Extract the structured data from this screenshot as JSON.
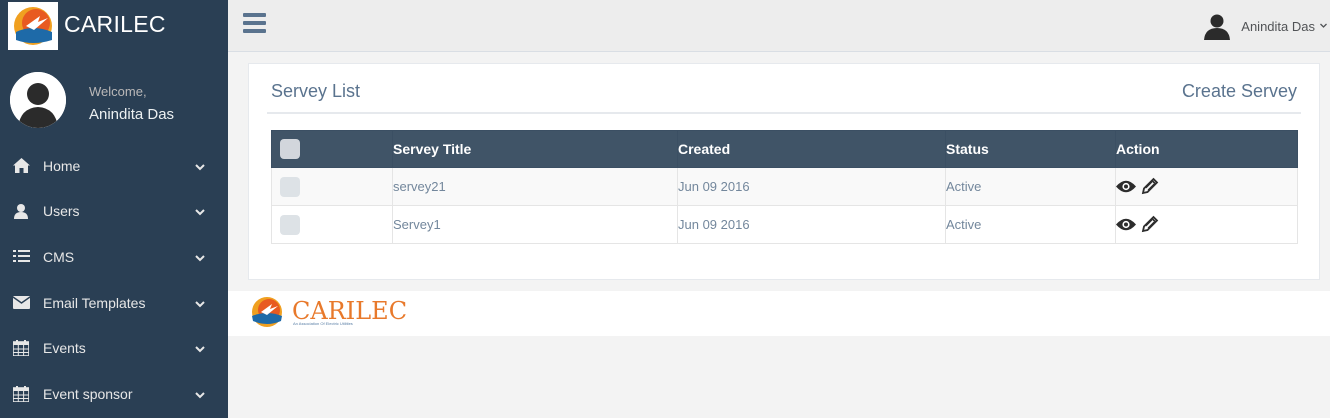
{
  "brand": {
    "title": "CARILEC"
  },
  "profile": {
    "welcome": "Welcome,",
    "name": "Anindita Das"
  },
  "sidebar": {
    "items": [
      {
        "label": "Home",
        "icon": "home-icon"
      },
      {
        "label": "Users",
        "icon": "user-icon"
      },
      {
        "label": "CMS",
        "icon": "list-icon"
      },
      {
        "label": "Email Templates",
        "icon": "envelope-icon"
      },
      {
        "label": "Events",
        "icon": "calendar-icon"
      },
      {
        "label": "Event sponsor",
        "icon": "calendar-icon"
      }
    ]
  },
  "topbar": {
    "user_name": "Anindita Das"
  },
  "panel": {
    "title": "Servey List",
    "create_label": "Create Servey"
  },
  "table": {
    "headers": [
      "Servey Title",
      "Created",
      "Status",
      "Action"
    ],
    "rows": [
      {
        "title": "servey21",
        "created": "Jun 09 2016",
        "status": "Active"
      },
      {
        "title": "Servey1",
        "created": "Jun 09 2016",
        "status": "Active"
      }
    ]
  },
  "footer": {
    "brand": "CARILEC",
    "tagline": "An Association Of Electric Utilities"
  },
  "colors": {
    "sidebar_bg": "#2a3f54",
    "table_header_bg": "#405467",
    "accent_orange": "#e8792b",
    "text_blue": "#5a738e"
  }
}
